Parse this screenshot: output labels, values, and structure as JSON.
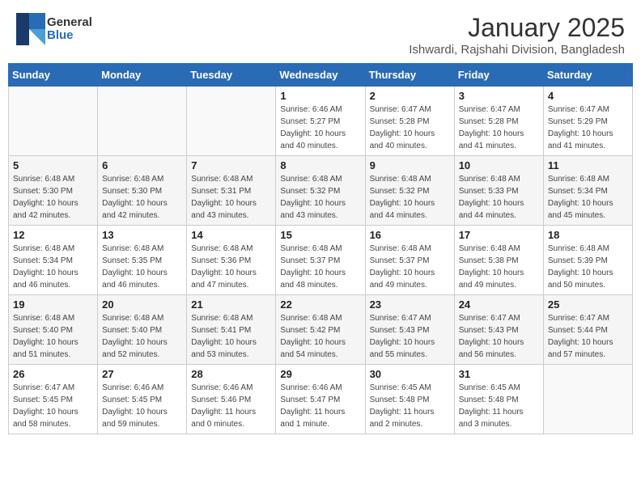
{
  "header": {
    "logo_general": "General",
    "logo_blue": "Blue",
    "title": "January 2025",
    "subtitle": "Ishwardi, Rajshahi Division, Bangladesh"
  },
  "weekdays": [
    "Sunday",
    "Monday",
    "Tuesday",
    "Wednesday",
    "Thursday",
    "Friday",
    "Saturday"
  ],
  "weeks": [
    [
      {
        "day": "",
        "info": ""
      },
      {
        "day": "",
        "info": ""
      },
      {
        "day": "",
        "info": ""
      },
      {
        "day": "1",
        "info": "Sunrise: 6:46 AM\nSunset: 5:27 PM\nDaylight: 10 hours\nand 40 minutes."
      },
      {
        "day": "2",
        "info": "Sunrise: 6:47 AM\nSunset: 5:28 PM\nDaylight: 10 hours\nand 40 minutes."
      },
      {
        "day": "3",
        "info": "Sunrise: 6:47 AM\nSunset: 5:28 PM\nDaylight: 10 hours\nand 41 minutes."
      },
      {
        "day": "4",
        "info": "Sunrise: 6:47 AM\nSunset: 5:29 PM\nDaylight: 10 hours\nand 41 minutes."
      }
    ],
    [
      {
        "day": "5",
        "info": "Sunrise: 6:48 AM\nSunset: 5:30 PM\nDaylight: 10 hours\nand 42 minutes."
      },
      {
        "day": "6",
        "info": "Sunrise: 6:48 AM\nSunset: 5:30 PM\nDaylight: 10 hours\nand 42 minutes."
      },
      {
        "day": "7",
        "info": "Sunrise: 6:48 AM\nSunset: 5:31 PM\nDaylight: 10 hours\nand 43 minutes."
      },
      {
        "day": "8",
        "info": "Sunrise: 6:48 AM\nSunset: 5:32 PM\nDaylight: 10 hours\nand 43 minutes."
      },
      {
        "day": "9",
        "info": "Sunrise: 6:48 AM\nSunset: 5:32 PM\nDaylight: 10 hours\nand 44 minutes."
      },
      {
        "day": "10",
        "info": "Sunrise: 6:48 AM\nSunset: 5:33 PM\nDaylight: 10 hours\nand 44 minutes."
      },
      {
        "day": "11",
        "info": "Sunrise: 6:48 AM\nSunset: 5:34 PM\nDaylight: 10 hours\nand 45 minutes."
      }
    ],
    [
      {
        "day": "12",
        "info": "Sunrise: 6:48 AM\nSunset: 5:34 PM\nDaylight: 10 hours\nand 46 minutes."
      },
      {
        "day": "13",
        "info": "Sunrise: 6:48 AM\nSunset: 5:35 PM\nDaylight: 10 hours\nand 46 minutes."
      },
      {
        "day": "14",
        "info": "Sunrise: 6:48 AM\nSunset: 5:36 PM\nDaylight: 10 hours\nand 47 minutes."
      },
      {
        "day": "15",
        "info": "Sunrise: 6:48 AM\nSunset: 5:37 PM\nDaylight: 10 hours\nand 48 minutes."
      },
      {
        "day": "16",
        "info": "Sunrise: 6:48 AM\nSunset: 5:37 PM\nDaylight: 10 hours\nand 49 minutes."
      },
      {
        "day": "17",
        "info": "Sunrise: 6:48 AM\nSunset: 5:38 PM\nDaylight: 10 hours\nand 49 minutes."
      },
      {
        "day": "18",
        "info": "Sunrise: 6:48 AM\nSunset: 5:39 PM\nDaylight: 10 hours\nand 50 minutes."
      }
    ],
    [
      {
        "day": "19",
        "info": "Sunrise: 6:48 AM\nSunset: 5:40 PM\nDaylight: 10 hours\nand 51 minutes."
      },
      {
        "day": "20",
        "info": "Sunrise: 6:48 AM\nSunset: 5:40 PM\nDaylight: 10 hours\nand 52 minutes."
      },
      {
        "day": "21",
        "info": "Sunrise: 6:48 AM\nSunset: 5:41 PM\nDaylight: 10 hours\nand 53 minutes."
      },
      {
        "day": "22",
        "info": "Sunrise: 6:48 AM\nSunset: 5:42 PM\nDaylight: 10 hours\nand 54 minutes."
      },
      {
        "day": "23",
        "info": "Sunrise: 6:47 AM\nSunset: 5:43 PM\nDaylight: 10 hours\nand 55 minutes."
      },
      {
        "day": "24",
        "info": "Sunrise: 6:47 AM\nSunset: 5:43 PM\nDaylight: 10 hours\nand 56 minutes."
      },
      {
        "day": "25",
        "info": "Sunrise: 6:47 AM\nSunset: 5:44 PM\nDaylight: 10 hours\nand 57 minutes."
      }
    ],
    [
      {
        "day": "26",
        "info": "Sunrise: 6:47 AM\nSunset: 5:45 PM\nDaylight: 10 hours\nand 58 minutes."
      },
      {
        "day": "27",
        "info": "Sunrise: 6:46 AM\nSunset: 5:45 PM\nDaylight: 10 hours\nand 59 minutes."
      },
      {
        "day": "28",
        "info": "Sunrise: 6:46 AM\nSunset: 5:46 PM\nDaylight: 11 hours\nand 0 minutes."
      },
      {
        "day": "29",
        "info": "Sunrise: 6:46 AM\nSunset: 5:47 PM\nDaylight: 11 hours\nand 1 minute."
      },
      {
        "day": "30",
        "info": "Sunrise: 6:45 AM\nSunset: 5:48 PM\nDaylight: 11 hours\nand 2 minutes."
      },
      {
        "day": "31",
        "info": "Sunrise: 6:45 AM\nSunset: 5:48 PM\nDaylight: 11 hours\nand 3 minutes."
      },
      {
        "day": "",
        "info": ""
      }
    ]
  ]
}
